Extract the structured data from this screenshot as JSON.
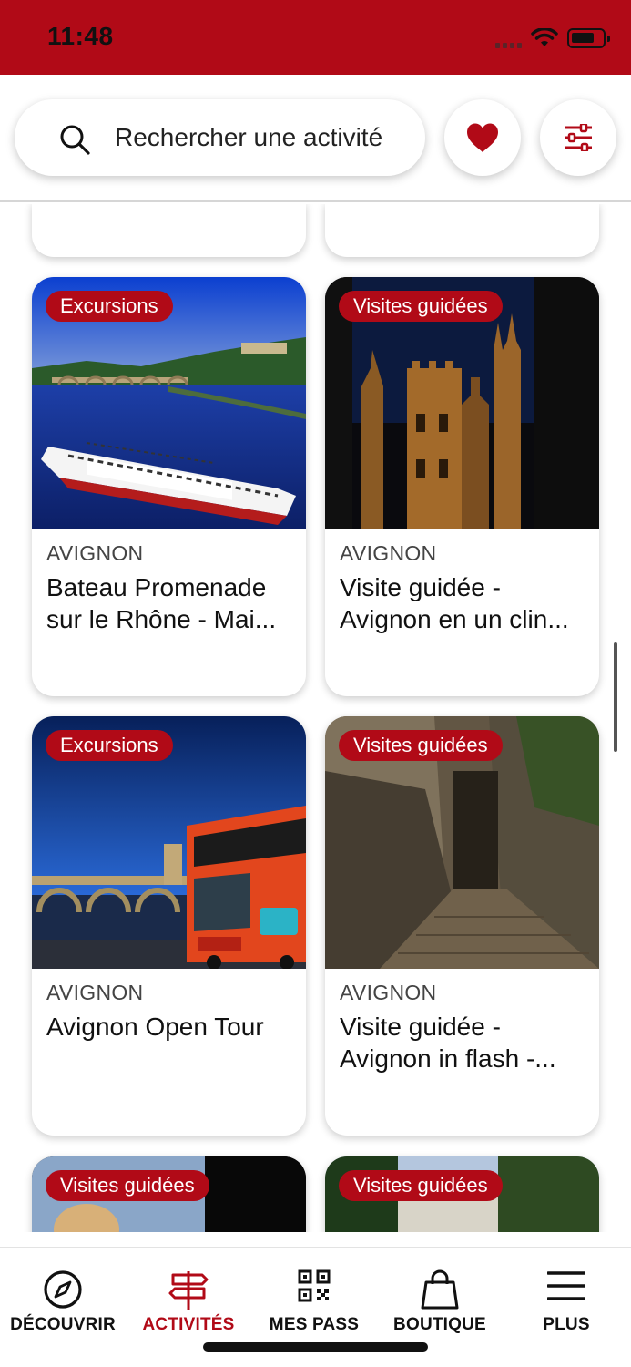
{
  "status_bar": {
    "time": "11:48"
  },
  "search": {
    "placeholder": "Rechercher une activité"
  },
  "colors": {
    "brand": "#b10a17",
    "text": "#111111",
    "muted": "#444444"
  },
  "icons": {
    "search": "search-icon",
    "favorites": "heart-icon",
    "filters": "sliders-icon"
  },
  "cards": [
    {
      "tag": "Excursions",
      "city": "AVIGNON",
      "title": "Bateau Promenade sur le  Rhône - Mai..."
    },
    {
      "tag": "Visites guidées",
      "city": "AVIGNON",
      "title": "Visite guidée - Avignon en un clin..."
    },
    {
      "tag": "Excursions",
      "city": "AVIGNON",
      "title": "Avignon Open Tour"
    },
    {
      "tag": "Visites guidées",
      "city": "AVIGNON",
      "title": "Visite guidée - Avignon in flash  -..."
    },
    {
      "tag": "Visites guidées"
    },
    {
      "tag": "Visites guidées"
    }
  ],
  "bottom_nav": {
    "items": [
      {
        "label": "DÉCOUVRIR",
        "icon": "compass-icon"
      },
      {
        "label": "ACTIVITÉS",
        "icon": "signpost-icon",
        "active": true
      },
      {
        "label": "MES PASS",
        "icon": "qr-code-icon"
      },
      {
        "label": "BOUTIQUE",
        "icon": "shopping-bag-icon"
      },
      {
        "label": "PLUS",
        "icon": "menu-icon"
      }
    ]
  }
}
